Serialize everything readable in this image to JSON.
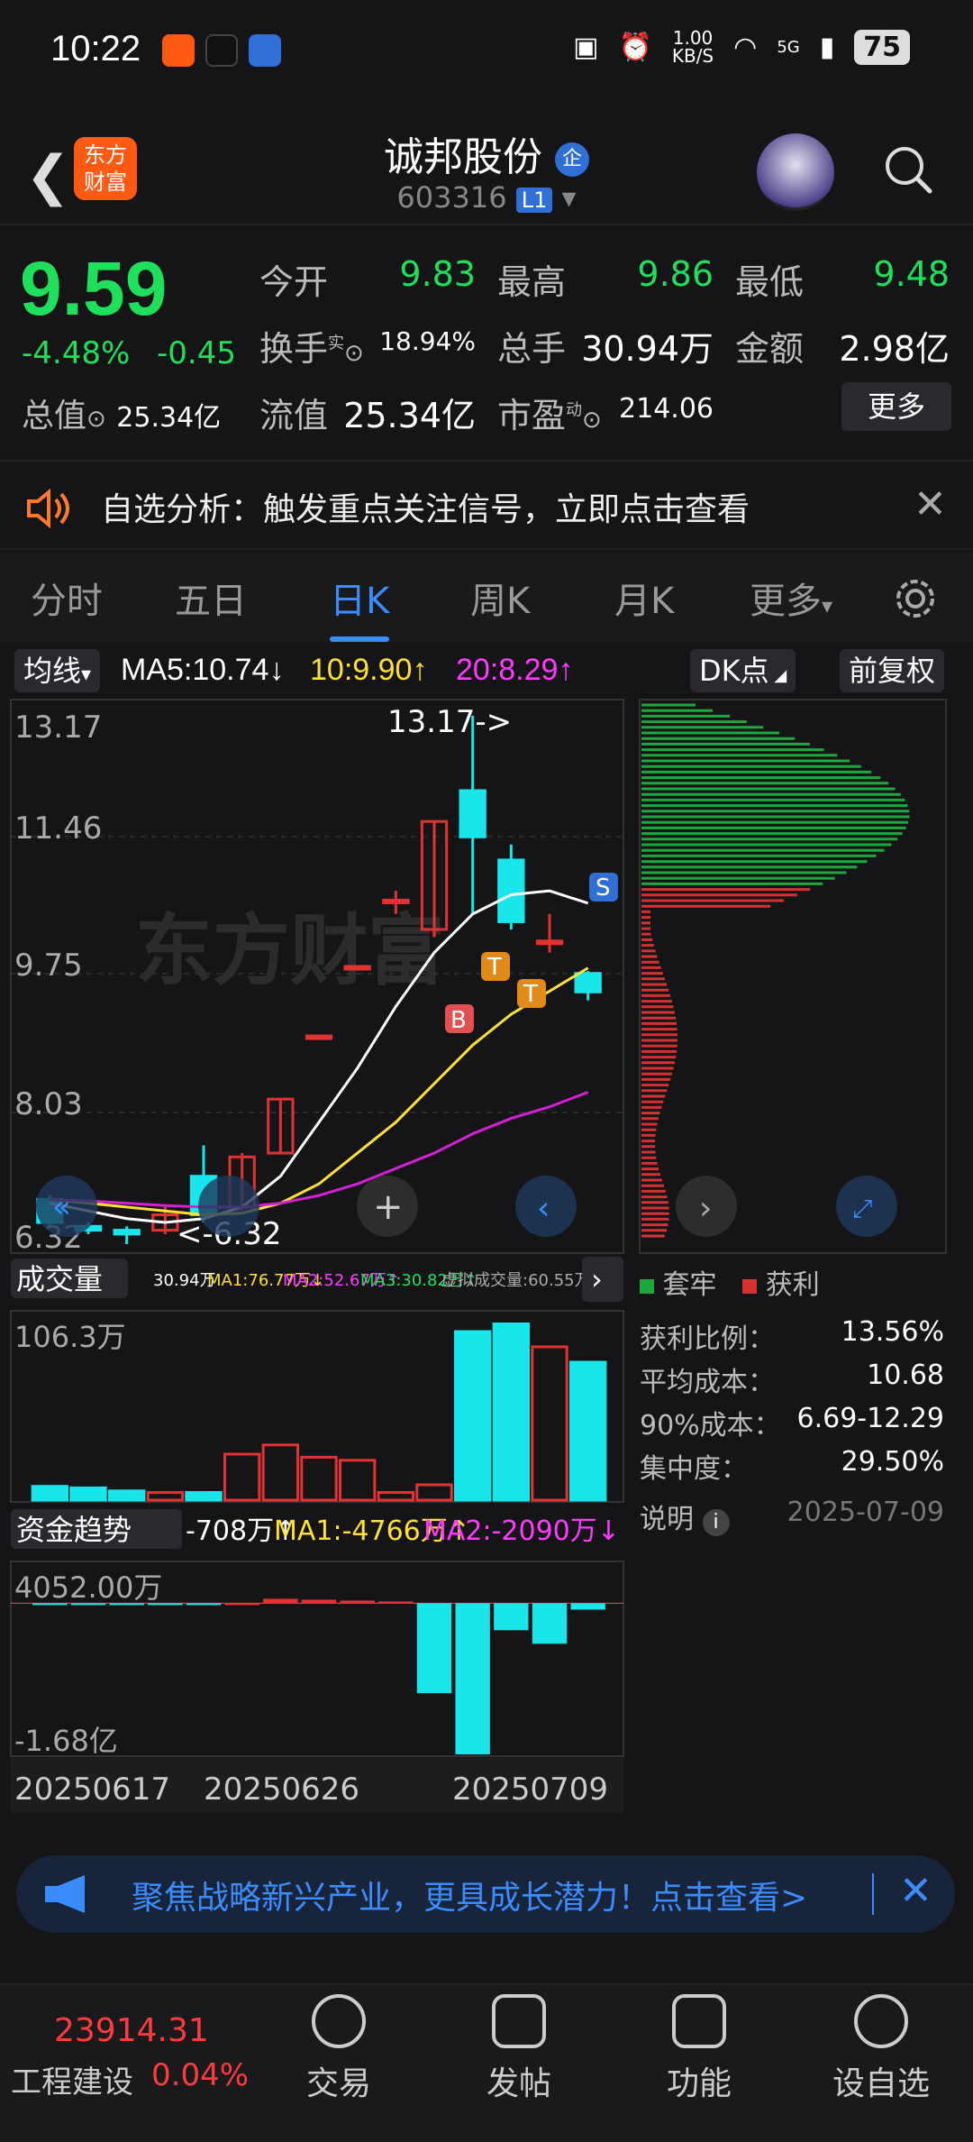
{
  "status": {
    "time": "10:22",
    "speed": "1.00",
    "speed_unit": "KB/S",
    "battery": "75",
    "net": "5G"
  },
  "header": {
    "logo": "东方财富",
    "title": "诚邦股份",
    "badge": "企",
    "code": "603316",
    "level": "L1"
  },
  "quote": {
    "price": "9.59",
    "pct": "-4.48%",
    "chg": "-0.45",
    "open_label": "今开",
    "open": "9.83",
    "high_label": "最高",
    "high": "9.86",
    "low_label": "最低",
    "low": "9.48",
    "turnover_label": "换手",
    "turnover_sup": "实",
    "turnover": "18.94%",
    "vol_label": "总手",
    "vol": "30.94万",
    "amt_label": "金额",
    "amt": "2.98亿",
    "mcap_label": "总值",
    "mcap": "25.34亿",
    "float_label": "流值",
    "float": "25.34亿",
    "pe_label": "市盈",
    "pe_sup": "动",
    "pe": "214.06",
    "more": "更多"
  },
  "banner": {
    "text": "自选分析：触发重点关注信号，立即点击查看"
  },
  "tabs": [
    "分时",
    "五日",
    "日K",
    "周K",
    "月K",
    "更多"
  ],
  "active_tab": "日K",
  "ma": {
    "label": "均线",
    "ma5": "MA5:10.74↓",
    "ma10": "10:9.90↑",
    "ma20": "20:8.29↑",
    "dk": "DK点",
    "adj": "前复权"
  },
  "kline": {
    "y_labels": [
      "13.17",
      "11.46",
      "9.75",
      "8.03",
      "6.32"
    ],
    "max_note": "13.17->",
    "min_note": "<-6.32",
    "markers": [
      "B",
      "T",
      "T",
      "S"
    ],
    "watermark": "东方财富"
  },
  "volume": {
    "label": "成交量",
    "stats": [
      "30.94万",
      "MA1:76.77万↓",
      "MA2:52.67万↑",
      "MA3:30.82万↑",
      "虚拟成交量:60.55万"
    ],
    "ytop": "106.3万"
  },
  "fund": {
    "label": "资金趋势",
    "val": "-708万↑",
    "ma1": "MA1:-4766万↑",
    "ma2": "MA2:-2090万↓",
    "ytop": "4052.00万",
    "ybot": "-1.68亿"
  },
  "dates": [
    "20250617",
    "20250626",
    "20250709"
  ],
  "chip_panel": {
    "legend_trap": "套牢",
    "legend_profit": "获利",
    "rows": [
      {
        "k": "获利比例：",
        "v": "13.56%"
      },
      {
        "k": "平均成本：",
        "v": "10.68"
      },
      {
        "k": "90%成本：",
        "v": "6.69-12.29"
      },
      {
        "k": "集中度：",
        "v": "29.50%"
      }
    ],
    "note": "说明",
    "date": "2025-07-09"
  },
  "ad": {
    "text": "聚焦战略新兴产业，更具成长潜力！点击查看>"
  },
  "bottom": {
    "index_val": "23914.31",
    "index_name": "工程建设",
    "index_pct": "0.04%",
    "items": [
      "交易",
      "发帖",
      "功能",
      "设自选"
    ]
  },
  "chart_data": {
    "type": "candlestick",
    "ylim": [
      6.32,
      13.17
    ],
    "candles": [
      {
        "o": 6.9,
        "c": 6.6,
        "h": 6.95,
        "l": 6.55,
        "up": false
      },
      {
        "o": 6.55,
        "c": 6.5,
        "h": 6.6,
        "l": 6.45,
        "up": false
      },
      {
        "o": 6.5,
        "c": 6.45,
        "h": 6.55,
        "l": 6.32,
        "up": false
      },
      {
        "o": 6.5,
        "c": 6.7,
        "h": 6.8,
        "l": 6.45,
        "up": true
      },
      {
        "o": 6.7,
        "c": 7.2,
        "h": 7.6,
        "l": 6.6,
        "up": false
      },
      {
        "o": 6.8,
        "c": 7.45,
        "h": 7.5,
        "l": 6.75,
        "up": true
      },
      {
        "o": 7.5,
        "c": 8.2,
        "h": 8.2,
        "l": 7.5,
        "up": true
      },
      {
        "o": 9.02,
        "c": 9.02,
        "h": 9.02,
        "l": 9.02,
        "up": true
      },
      {
        "o": 9.92,
        "c": 9.92,
        "h": 9.92,
        "l": 9.92,
        "up": true
      },
      {
        "o": 10.78,
        "c": 10.78,
        "h": 10.9,
        "l": 10.6,
        "up": true
      },
      {
        "o": 10.4,
        "c": 11.8,
        "h": 11.8,
        "l": 10.3,
        "up": true
      },
      {
        "o": 12.2,
        "c": 11.6,
        "h": 13.17,
        "l": 10.6,
        "up": false
      },
      {
        "o": 11.3,
        "c": 10.5,
        "h": 11.5,
        "l": 10.4,
        "up": false
      },
      {
        "o": 10.25,
        "c": 10.25,
        "h": 10.6,
        "l": 10.1,
        "up": true
      },
      {
        "o": 9.83,
        "c": 9.59,
        "h": 9.86,
        "l": 9.48,
        "up": false
      }
    ],
    "ma5": [
      6.85,
      6.75,
      6.65,
      6.6,
      6.65,
      6.8,
      7.2,
      7.9,
      8.6,
      9.4,
      10.1,
      10.6,
      10.85,
      10.9,
      10.74
    ],
    "ma10": [
      6.9,
      6.85,
      6.8,
      6.75,
      6.7,
      6.72,
      6.85,
      7.1,
      7.5,
      7.9,
      8.4,
      8.9,
      9.3,
      9.6,
      9.9
    ],
    "ma20": [
      6.9,
      6.88,
      6.85,
      6.82,
      6.8,
      6.8,
      6.85,
      6.95,
      7.1,
      7.3,
      7.5,
      7.75,
      7.95,
      8.1,
      8.29
    ],
    "volume": [
      9,
      8,
      6,
      5,
      5,
      30,
      36,
      28,
      26,
      5,
      10,
      110,
      115,
      100,
      90
    ],
    "fund": [
      -50,
      -100,
      -80,
      -60,
      -30,
      0,
      500,
      400,
      300,
      200,
      -10000,
      -16800,
      -3000,
      -4500,
      -708
    ]
  }
}
